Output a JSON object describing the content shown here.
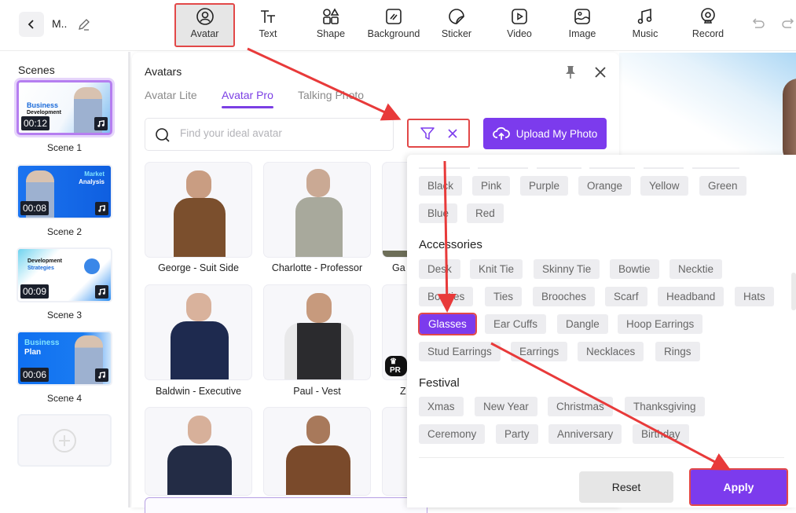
{
  "topbar": {
    "project_title": "M..",
    "tools": [
      {
        "label": "Avatar",
        "icon": "avatar-icon",
        "active": true
      },
      {
        "label": "Text",
        "icon": "text-icon"
      },
      {
        "label": "Shape",
        "icon": "shape-icon"
      },
      {
        "label": "Background",
        "icon": "background-icon"
      },
      {
        "label": "Sticker",
        "icon": "sticker-icon"
      },
      {
        "label": "Video",
        "icon": "video-icon"
      },
      {
        "label": "Image",
        "icon": "image-icon"
      },
      {
        "label": "Music",
        "icon": "music-icon"
      },
      {
        "label": "Record",
        "icon": "record-icon"
      }
    ]
  },
  "scenes": {
    "title": "Scenes",
    "items": [
      {
        "label": "Scene 1",
        "duration": "00:12",
        "thumb_title": "Business",
        "thumb_subtitle": "Development",
        "selected": true
      },
      {
        "label": "Scene 2",
        "duration": "00:08",
        "thumb_title": "Market",
        "thumb_subtitle": "Analysis"
      },
      {
        "label": "Scene 3",
        "duration": "00:09",
        "thumb_title": "Development",
        "thumb_subtitle": "Strategies"
      },
      {
        "label": "Scene 4",
        "duration": "00:06",
        "thumb_title": "Business",
        "thumb_subtitle": "Plan"
      }
    ]
  },
  "panel": {
    "title": "Avatars",
    "tabs": [
      {
        "label": "Avatar Lite"
      },
      {
        "label": "Avatar Pro",
        "active": true
      },
      {
        "label": "Talking Photo"
      }
    ],
    "search_placeholder": "Find your ideal avatar",
    "upload_label": "Upload My Photo",
    "avatars": [
      {
        "name": "George - Suit Side"
      },
      {
        "name": "Charlotte - Professor"
      },
      {
        "name": "Ga"
      },
      {
        "name": "Baldwin - Executive"
      },
      {
        "name": "Paul - Vest"
      },
      {
        "name": "Z",
        "badge": "PR"
      },
      {
        "name": ""
      },
      {
        "name": ""
      },
      {
        "name": ""
      }
    ]
  },
  "filter": {
    "colors": [
      "Black",
      "Pink",
      "Purple",
      "Orange",
      "Yellow",
      "Green",
      "Blue",
      "Red"
    ],
    "sections": [
      {
        "title": "Accessories",
        "chips": [
          "Desk",
          "Knit Tie",
          "Skinny Tie",
          "Bowtie",
          "Necktie",
          "Bowties",
          "Ties",
          "Brooches",
          "Scarf",
          "Headband",
          "Hats",
          "Glasses",
          "Ear Cuffs",
          "Dangle",
          "Hoop Earrings",
          "Stud Earrings",
          "Earrings",
          "Necklaces",
          "Rings"
        ],
        "selected": "Glasses"
      },
      {
        "title": "Festival",
        "chips": [
          "Xmas",
          "New Year",
          "Christmas",
          "Thanksgiving",
          "Ceremony",
          "Party",
          "Anniversary",
          "Birthday"
        ]
      }
    ],
    "reset_label": "Reset",
    "apply_label": "Apply"
  },
  "colors": {
    "accent": "#7c3bed",
    "annotation": "#e24848"
  }
}
